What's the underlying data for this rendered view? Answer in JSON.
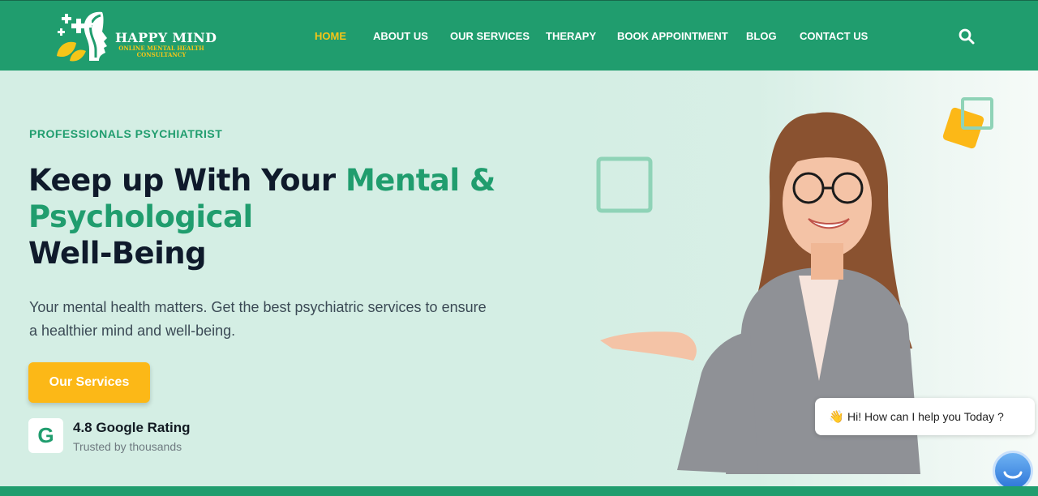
{
  "brand": {
    "name": "HAPPY MIND",
    "tagline_line1": "ONLINE MENTAL HEALTH",
    "tagline_line2": "CONSULTANCY"
  },
  "nav": {
    "items": [
      {
        "label": "HOME",
        "active": true
      },
      {
        "label": "ABOUT US",
        "active": false
      },
      {
        "label": "OUR SERVICES",
        "active": false
      },
      {
        "label": "THERAPY",
        "active": false
      },
      {
        "label": "BOOK APPOINTMENT",
        "active": false
      },
      {
        "label": "BLOG",
        "active": false
      },
      {
        "label": "CONTACT US",
        "active": false
      }
    ],
    "search_icon": "search-icon"
  },
  "hero": {
    "eyebrow": "PROFESSIONALS PSYCHIATRIST",
    "headline_part1": "Keep up With Your ",
    "headline_accent": "Mental & Psychological",
    "headline_part2": "Well-Being",
    "description": "Your mental health matters. Get the best psychiatric services to ensure a healthier mind and well-being.",
    "cta_label": "Our Services",
    "rating_badge_letter": "G",
    "rating_title": "4.8 Google Rating",
    "rating_subtitle": "Trusted by thousands"
  },
  "chat_widget": {
    "emoji": "👋",
    "message": "Hi! How can I help you Today ?",
    "launcher_icon": "chat-bot-icon"
  },
  "colors": {
    "primary": "#209d6e",
    "accent": "#fcb817",
    "hero_bg": "#d4eee4",
    "heading": "#0f1a2b"
  }
}
